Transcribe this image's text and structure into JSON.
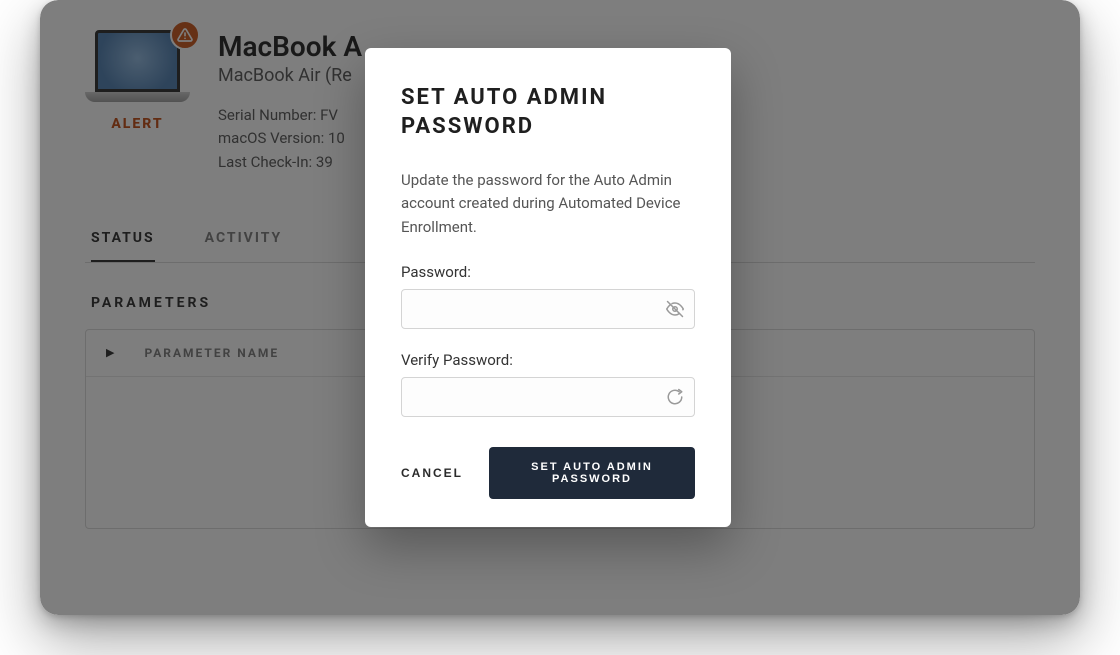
{
  "device": {
    "thumb_alert_label": "ALERT",
    "title": "MacBook A",
    "subtitle": "MacBook Air (Re",
    "serial_label": "Serial Number:",
    "serial_value": "FV",
    "os_label": "macOS Version:",
    "os_value": "10",
    "checkin_label": "Last Check-In:",
    "checkin_value": "39"
  },
  "tabs": {
    "status": "STATUS",
    "activity": "ACTIVITY"
  },
  "parameters": {
    "section_title": "PARAMETERS",
    "column_name_header": "PARAMETER NAME"
  },
  "modal": {
    "title": "SET AUTO ADMIN PASSWORD",
    "description": "Update the password for the Auto Admin account created during Automated Device Enrollment.",
    "password_label": "Password:",
    "verify_password_label": "Verify Password:",
    "password_value": "",
    "verify_password_value": "",
    "cancel_label": "CANCEL",
    "submit_label": "SET AUTO ADMIN PASSWORD"
  },
  "icons": {
    "alert": "alert-triangle",
    "eye_off": "eye-off",
    "spinner": "loading-spinner"
  }
}
